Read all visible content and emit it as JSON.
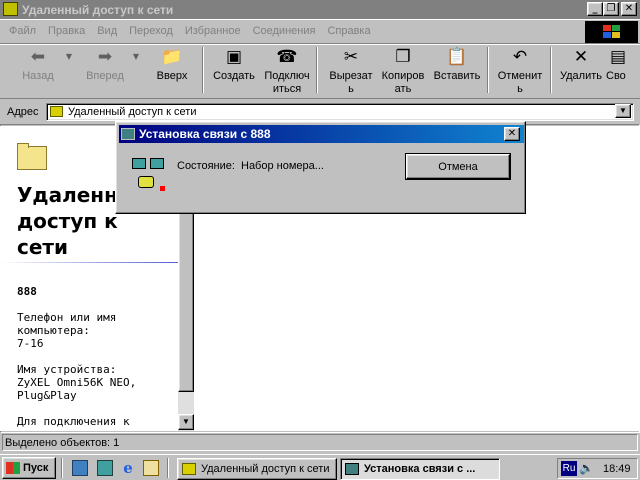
{
  "window": {
    "title": "Удаленный доступ к сети"
  },
  "menu": [
    "Файл",
    "Правка",
    "Вид",
    "Переход",
    "Избранное",
    "Соединения",
    "Справка"
  ],
  "toolbar": {
    "back": "Назад",
    "forward": "Вперед",
    "up": "Вверх",
    "create": "Создать",
    "connect1": "Подключ",
    "connect2": "иться",
    "cut1": "Вырезат",
    "cut2": "ь",
    "copy1": "Копиров",
    "copy2": "ать",
    "paste": "Вставить",
    "undo1": "Отменит",
    "undo2": "ь",
    "delete": "Удалить",
    "props": "Сво"
  },
  "address": {
    "label": "Адрес",
    "value": "Удаленный доступ к сети"
  },
  "left_pane": {
    "heading1": "Удаленн",
    "heading2": "доступ к",
    "heading3": "сети",
    "name": "888",
    "phone_label1": "Телефон или имя",
    "phone_label2": "компьютера:",
    "phone_value": "7-16",
    "device_label": "Имя устройства:",
    "device_value1": "ZyXEL Omni56K NEO,",
    "device_value2": "Plug&Play",
    "conn_label": "Для подключения к"
  },
  "status_bar": {
    "text": "Выделено объектов: 1"
  },
  "dialog": {
    "title": "Установка связи с 888",
    "state_label": "Состояние:",
    "state_value": "Набор номера...",
    "cancel": "Отмена"
  },
  "taskbar": {
    "start": "Пуск",
    "task1": "Удаленный доступ к сети",
    "task2": "Установка связи с ...",
    "lang": "Ru",
    "time": "18:49"
  }
}
